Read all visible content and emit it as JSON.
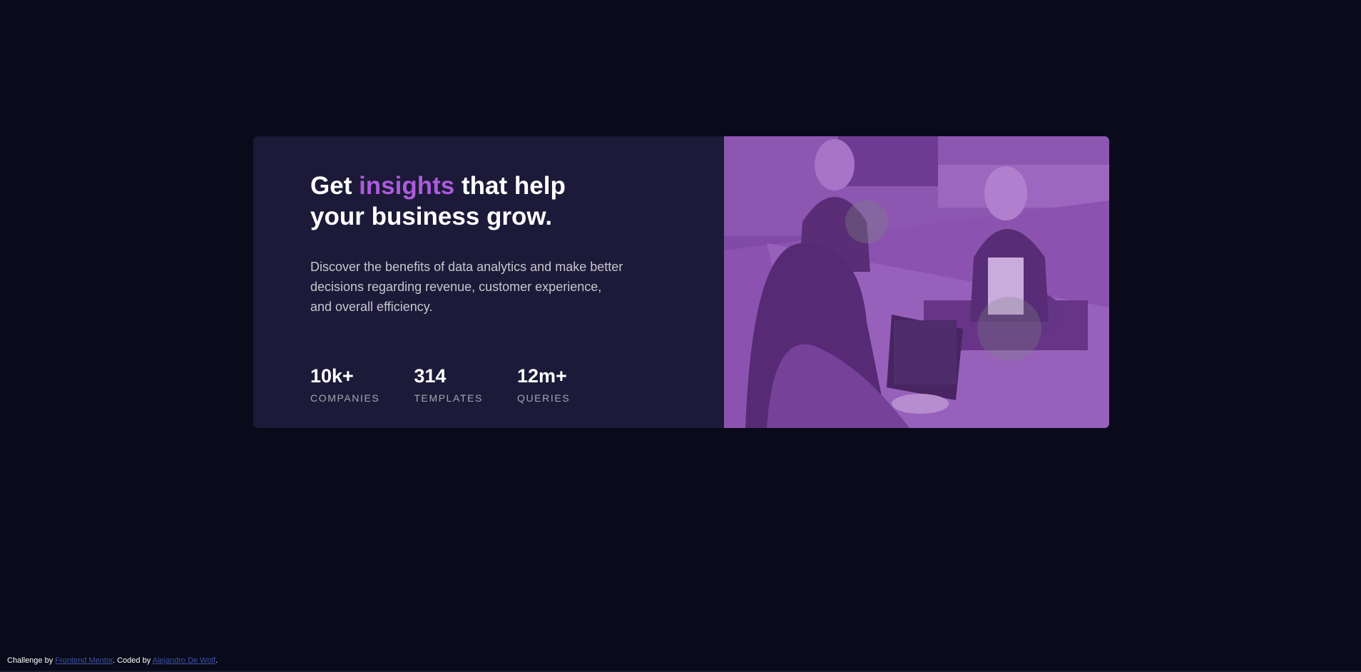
{
  "card": {
    "headline_start": "Get ",
    "headline_accent": "insights",
    "headline_end": " that help your business grow.",
    "description": "Discover the benefits of data analytics and make better decisions regarding revenue, customer experience, and overall efficiency.",
    "stats": [
      {
        "value": "10k+",
        "label": "COMPANIES"
      },
      {
        "value": "314",
        "label": "TEMPLATES"
      },
      {
        "value": "12m+",
        "label": "QUERIES"
      }
    ],
    "image_icon": "office-photo"
  },
  "footer": {
    "challenge_prefix": "Challenge by ",
    "challenge_link": "Frontend Mentor",
    "coded_prefix": ". Coded by ",
    "author_link": "Alejandro De Wolf",
    "suffix": "."
  },
  "colors": {
    "background": "#090b1a",
    "card": "#1c1a38",
    "accent": "#ab5cdb",
    "image_overlay": "#8d4bb5",
    "link": "#3e52a3"
  }
}
